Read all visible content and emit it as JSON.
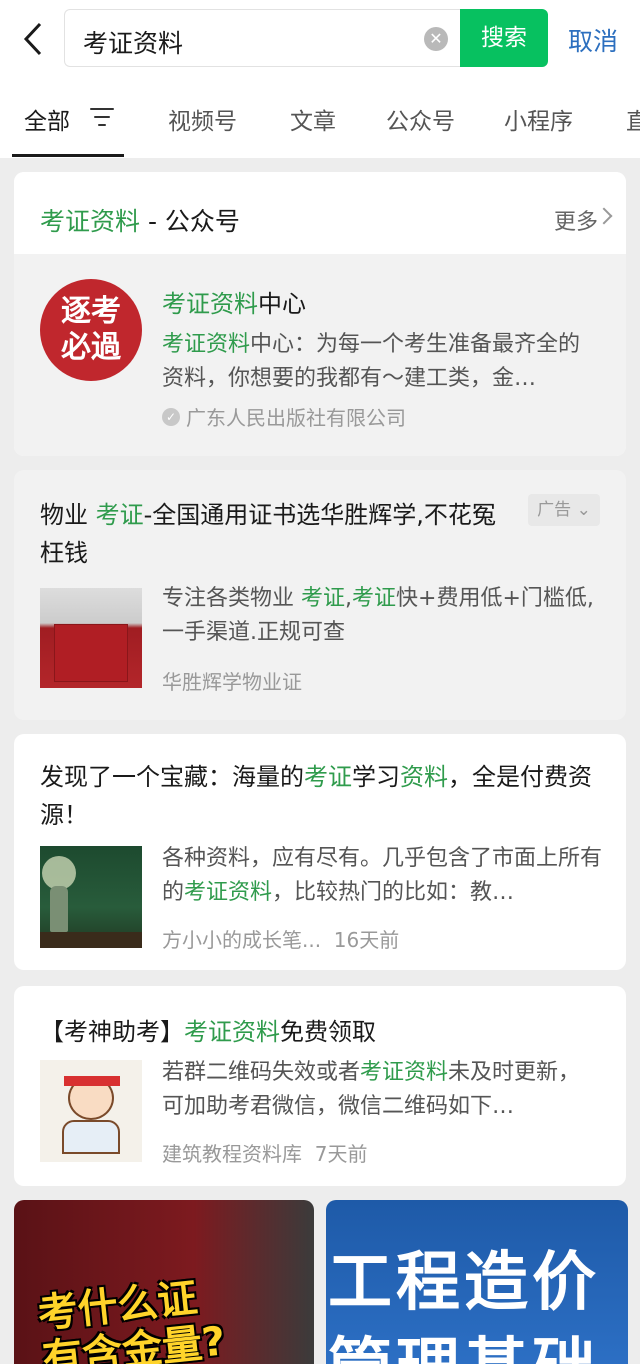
{
  "search": {
    "query": "考证资料",
    "button_label": "搜索",
    "cancel_label": "取消"
  },
  "tabs": [
    {
      "label": "全部",
      "active": true
    },
    {
      "label": "视频号"
    },
    {
      "label": "文章"
    },
    {
      "label": "公众号"
    },
    {
      "label": "小程序"
    },
    {
      "label": "直"
    }
  ],
  "account_section": {
    "keyword": "考证资料",
    "suffix": " - 公众号",
    "more_label": "更多",
    "account": {
      "logo_text": [
        "逐考",
        "必過"
      ],
      "name_highlight": "考证资料",
      "name_rest": "中心",
      "desc_highlight": "考证资料",
      "desc_rest": "中心：为每一个考生准备最齐全的资料，你想要的我都有～建工类，金…",
      "verified_by": "广东人民出版社有限公司"
    }
  },
  "ad": {
    "title_pre": "物业 ",
    "title_highlight": "考证",
    "title_rest": "-全国通用证书选华胜辉学,不花冤枉钱",
    "ad_label": "广告",
    "desc_pre": "专注各类物业 ",
    "desc_hl1": "考证",
    "desc_mid": ",",
    "desc_hl2": "考证",
    "desc_rest": "快+费用低+门槛低,一手渠道.正规可查",
    "source": "华胜辉学物业证"
  },
  "article1": {
    "title_pre": "发现了一个宝藏：海量的",
    "title_hl1": "考证",
    "title_mid": "学习",
    "title_hl2": "资料",
    "title_rest": "，全是付费资源！",
    "desc_pre": "各种资料，应有尽有。几乎包含了市面上所有的",
    "desc_hl": "考证资料",
    "desc_rest": "，比较热门的比如：教…",
    "source": "方小小的成长笔...",
    "time": "16天前"
  },
  "article2": {
    "title_pre": "【考神助考】",
    "title_hl": "考证资料",
    "title_rest": "免费领取",
    "desc_pre": "若群二维码失效或者",
    "desc_hl": "考证资料",
    "desc_rest": "未及时更新，可加助考君微信，微信二维码如下…",
    "source": "建筑教程资料库",
    "time": "7天前"
  },
  "videos": [
    {
      "caption": [
        "考什么证",
        "有含金量?"
      ]
    },
    {
      "caption": [
        "工程造价",
        "管理基础"
      ]
    }
  ],
  "colors": {
    "highlight": "#2f9b4c",
    "search_button": "#07c160",
    "cancel": "#2c6fbf"
  }
}
